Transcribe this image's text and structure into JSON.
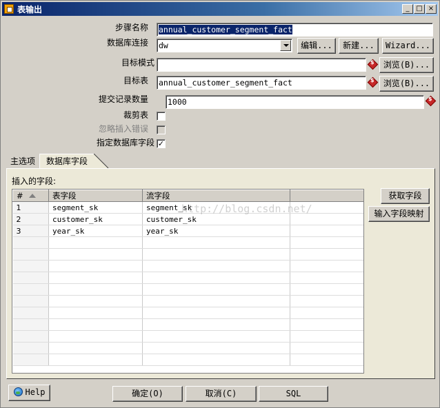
{
  "window": {
    "title": "表输出",
    "buttons": {
      "minimize": "_",
      "maximize": "□",
      "close": "×"
    }
  },
  "form": {
    "step_name_label": "步骤名称",
    "step_name_value": "annual_customer_segment_fact",
    "db_connection_label": "数据库连接",
    "db_connection_value": "dw",
    "edit_button": "编辑...",
    "new_button": "新建...",
    "wizard_button": "Wizard...",
    "target_schema_label": "目标模式",
    "target_schema_value": "",
    "browse_schema_button": "浏览(B)...",
    "target_table_label": "目标表",
    "target_table_value": "annual_customer_segment_fact",
    "browse_table_button": "浏览(B)...",
    "commit_size_label": "提交记录数量",
    "commit_size_value": "1000",
    "truncate_label": "裁剪表",
    "truncate_checked": "",
    "ignore_errors_label": "忽略插入错误",
    "ignore_errors_checked": "",
    "specify_fields_label": "指定数据库字段",
    "specify_fields_checked": "✓"
  },
  "tabs": {
    "main": "主选项",
    "db_fields": "数据库字段"
  },
  "fields_panel": {
    "label": "插入的字段:",
    "columns": [
      "#",
      "表字段",
      "流字段"
    ],
    "rows": [
      [
        "1",
        "segment_sk",
        "segment_sk"
      ],
      [
        "2",
        "customer_sk",
        "customer_sk"
      ],
      [
        "3",
        "year_sk",
        "year_sk"
      ]
    ],
    "get_fields_button": "获取字段",
    "enter_mapping_button": "输入字段映射"
  },
  "watermark": "http://blog.csdn.net/",
  "footer": {
    "help_button": "Help",
    "ok_button": "确定(O)",
    "cancel_button": "取消(C)",
    "sql_button": "SQL"
  }
}
